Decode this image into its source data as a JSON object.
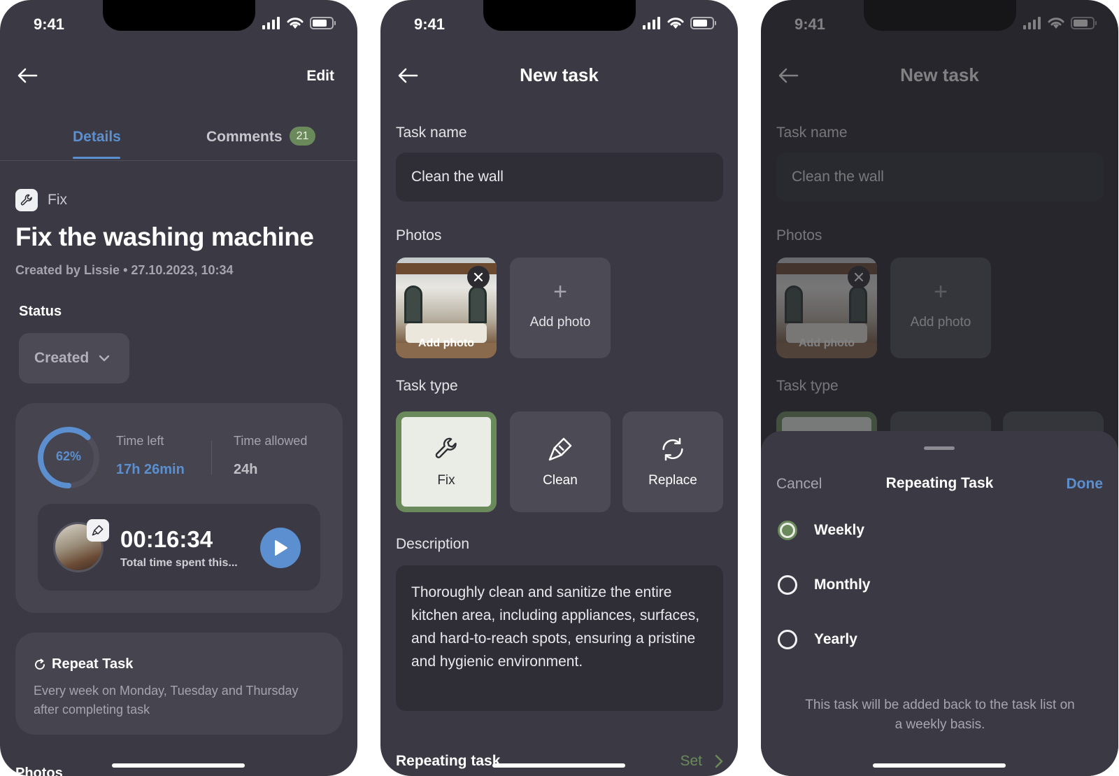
{
  "colors": {
    "background": "#3b3a44",
    "accent_blue": "#5b8fd0",
    "accent_green": "#6b8a5c",
    "muted_text": "#a6a5ad"
  },
  "status_bar": {
    "time": "9:41"
  },
  "details_screen": {
    "edit_label": "Edit",
    "tabs": {
      "details": "Details",
      "comments": "Comments",
      "comments_count": "21"
    },
    "task_type": "Fix",
    "title": "Fix the washing machine",
    "meta": "Created by Lissie  •  27.10.2023, 10:34",
    "status_label": "Status",
    "status_value": "Created",
    "progress": {
      "percent_label": "62%",
      "percent": 0.62,
      "time_left_label": "Time left",
      "time_left_value": "17h 26min",
      "time_allowed_label": "Time allowed",
      "time_allowed_value": "24h"
    },
    "timer": {
      "value": "00:16:34",
      "caption": "Total time spent this..."
    },
    "repeat": {
      "title": "Repeat Task",
      "description": "Every week on Monday, Tuesday and Thursday after completing task"
    },
    "photos_label": "Photos"
  },
  "new_task_screen": {
    "title": "New task",
    "task_name_label": "Task name",
    "task_name_value": "Clean the wall",
    "photos_label": "Photos",
    "photo_overlay_text": "Add photo",
    "add_photo_label": "Add photo",
    "task_type_label": "Task type",
    "task_types": [
      {
        "label": "Fix",
        "icon": "wrench-icon",
        "selected": true
      },
      {
        "label": "Clean",
        "icon": "brush-icon",
        "selected": false
      },
      {
        "label": "Replace",
        "icon": "replace-icon",
        "selected": false
      }
    ],
    "description_label": "Description",
    "description_value": "Thoroughly clean and sanitize the entire kitchen area, including appliances, surfaces, and hard-to-reach spots, ensuring a pristine and hygienic environment.",
    "repeating_label": "Repeating task",
    "repeating_action": "Set"
  },
  "repeat_sheet": {
    "cancel_label": "Cancel",
    "title": "Repeating Task",
    "done_label": "Done",
    "options": [
      {
        "label": "Weekly",
        "selected": true
      },
      {
        "label": "Monthly",
        "selected": false
      },
      {
        "label": "Yearly",
        "selected": false
      }
    ],
    "note": "This task will be added back to the task list on a weekly basis."
  }
}
